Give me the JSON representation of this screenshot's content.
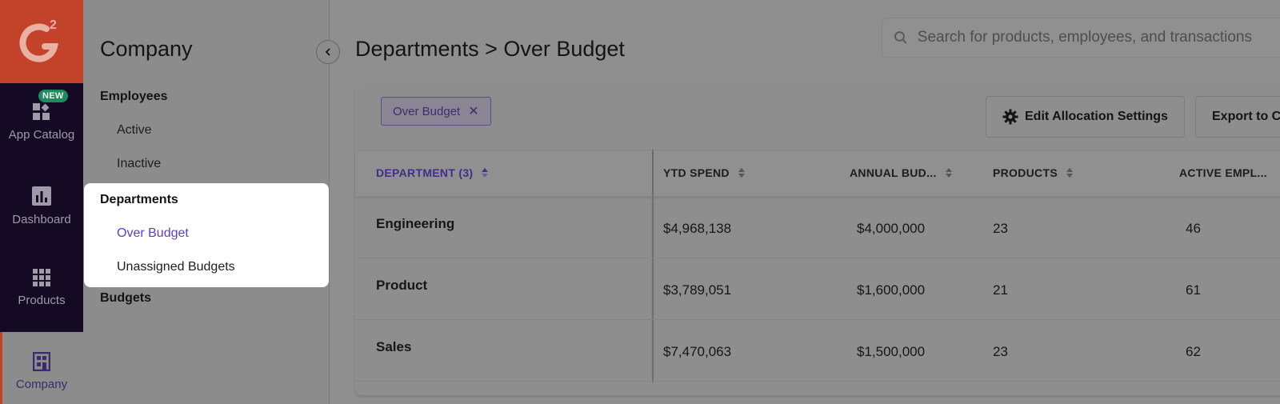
{
  "rail": {
    "items": [
      {
        "label": "App Catalog",
        "icon": "app-catalog-icon",
        "badge": "NEW"
      },
      {
        "label": "Dashboard",
        "icon": "dashboard-icon"
      },
      {
        "label": "Products",
        "icon": "products-grid-icon"
      },
      {
        "label": "Company",
        "icon": "company-building-icon",
        "active": true
      }
    ],
    "brand_color": "#c2432a"
  },
  "sidebar": {
    "title": "Company",
    "sections": [
      {
        "label": "Employees",
        "items": [
          "Active",
          "Inactive"
        ]
      },
      {
        "label": "Departments",
        "items": [
          "Over Budget",
          "Unassigned Budgets"
        ],
        "selected": "Over Budget"
      },
      {
        "label": "Budgets",
        "items": []
      }
    ]
  },
  "header": {
    "title": "Departments > Over Budget",
    "search_placeholder": "Search for products, employees, and transactions"
  },
  "filters": {
    "chip": "Over Budget"
  },
  "toolbar": {
    "edit_label": "Edit Allocation Settings",
    "export_label": "Export to CSV"
  },
  "table": {
    "columns": [
      "DEPARTMENT (3)",
      "YTD SPEND",
      "ANNUAL BUD...",
      "PRODUCTS",
      "ACTIVE EMPL..."
    ],
    "rows": [
      [
        "Engineering",
        "$4,968,138",
        "$4,000,000",
        "23",
        "46"
      ],
      [
        "Product",
        "$3,789,051",
        "$1,600,000",
        "21",
        "61"
      ],
      [
        "Sales",
        "$7,470,063",
        "$1,500,000",
        "23",
        "62"
      ]
    ]
  },
  "colors": {
    "accent": "#5b3fc4",
    "overlay": "#8e8e8e"
  }
}
